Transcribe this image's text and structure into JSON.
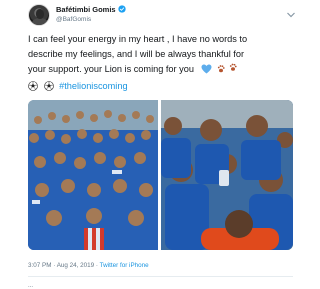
{
  "tweet": {
    "author": {
      "display_name": "Bafétimbi Gomis",
      "handle": "@BafGomis",
      "verified": true,
      "avatar_icon": "profile-photo-avatar"
    },
    "text_lines": [
      "I can feel your energy in my heart , I have no words to",
      "describe my feelings, and I will be always thankful for",
      "your support. your Lion is coming for you"
    ],
    "hashtag": "#thelioniscoming",
    "emoji": {
      "heart": "blue-heart-emoji",
      "paws": "paw-prints-emoji",
      "balls": "soccer-ball-emoji"
    },
    "media": [
      {
        "alt_icon": "crowd-of-fans-photo"
      },
      {
        "alt_icon": "fans-taking-photos-photo"
      }
    ],
    "timestamp": "3:07 PM · Aug 24, 2019",
    "source_prefix": " · ",
    "source": "Twitter for iPhone",
    "stats": "..."
  },
  "colors": {
    "link": "#1b95e0",
    "verified": "#1da1f2",
    "text": "#14171a",
    "muted": "#657786",
    "shirt_blue": "#1d58b8"
  }
}
